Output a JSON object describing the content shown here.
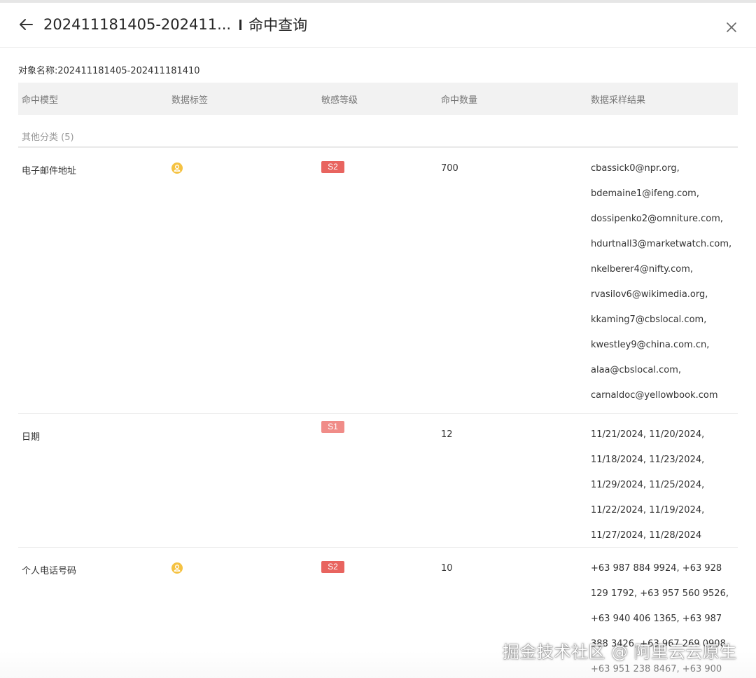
{
  "header": {
    "title_id": "202411181405-202411...",
    "title_label": "命中查询",
    "back_icon": "arrow-left-icon",
    "close_icon": "close-icon"
  },
  "object_name": "对象名称:202411181405-202411181410",
  "table": {
    "columns": [
      "命中模型",
      "数据标签",
      "敏感等级",
      "命中数量",
      "数据采样结果"
    ],
    "group_label": "其他分类 (5)",
    "rows": [
      {
        "model": "电子邮件地址",
        "has_tag_icon": true,
        "level": "S2",
        "count": "700",
        "samples": [
          "cbassick0@npr.org,",
          "bdemaine1@ifeng.com,",
          "dossipenko2@omniture.com,",
          "hdurtnall3@marketwatch.com,",
          "nkelberer4@nifty.com,",
          "rvasilov6@wikimedia.org,",
          "kkaming7@cbslocal.com,",
          "kwestley9@china.com.cn,",
          "alaa@cbslocal.com,",
          "carnaldoc@yellowbook.com"
        ]
      },
      {
        "model": "日期",
        "has_tag_icon": false,
        "level": "S1",
        "count": "12",
        "samples": [
          "11/21/2024, 11/20/2024,",
          "11/18/2024, 11/23/2024,",
          "11/29/2024, 11/25/2024,",
          "11/22/2024, 11/19/2024,",
          "11/27/2024, 11/28/2024"
        ]
      },
      {
        "model": "个人电话号码",
        "has_tag_icon": true,
        "level": "S2",
        "count": "10",
        "samples": [
          "+63 987 884 9924, +63 928",
          "129 1792, +63 957 560 9526,",
          "+63 940 406 1365, +63 987",
          "388 3426, +63 967 269 0908,",
          "+63 951 238 8467, +63 900"
        ]
      }
    ]
  },
  "colors": {
    "s2": "#e8645f",
    "s1": "#f08c88",
    "tag_icon": "#f5c242",
    "header_bg": "#f2f2f2"
  },
  "watermark": "掘金技术社区 @ 阿里云云原生"
}
